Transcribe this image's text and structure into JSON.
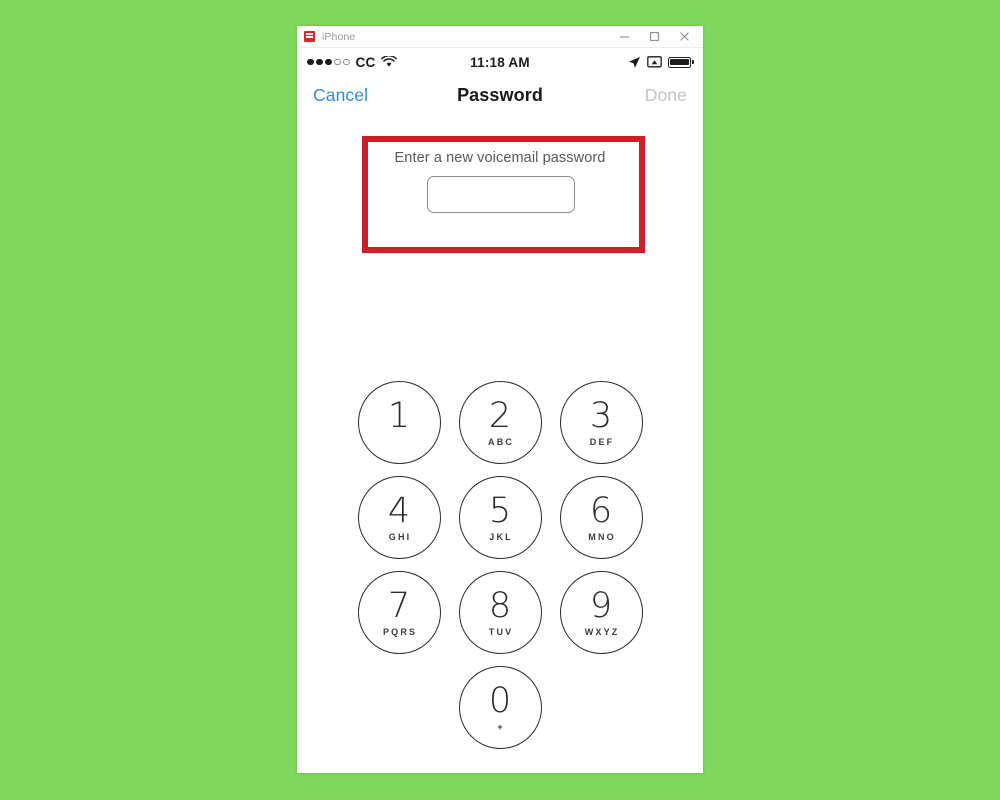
{
  "background_color": "#7fd85c",
  "window": {
    "title": "iPhone",
    "app_icon": "iphone-app-icon",
    "controls": [
      {
        "name": "minimize",
        "icon": "minimize-icon"
      },
      {
        "name": "maximize",
        "icon": "maximize-icon"
      },
      {
        "name": "close",
        "icon": "close-icon"
      }
    ]
  },
  "status_bar": {
    "signal_dots_filled": 3,
    "signal_dots_total": 5,
    "carrier": "CC",
    "wifi_icon": "wifi-icon",
    "time": "11:18 AM",
    "location_icon": "location-arrow-icon",
    "screen_mirror_icon": "screen-mirroring-icon",
    "battery_icon": "battery-icon",
    "battery_level_percent": 100
  },
  "nav_bar": {
    "cancel_label": "Cancel",
    "title": "Password",
    "done_label": "Done",
    "cancel_color": "#2e8ce6",
    "done_color": "#c3c3c3"
  },
  "password_section": {
    "prompt": "Enter a new voicemail password",
    "input_value": "",
    "input_placeholder": "",
    "annotation_color": "#cc2027"
  },
  "keypad": {
    "rows": [
      [
        {
          "digit": "1",
          "letters": ""
        },
        {
          "digit": "2",
          "letters": "ABC"
        },
        {
          "digit": "3",
          "letters": "DEF"
        }
      ],
      [
        {
          "digit": "4",
          "letters": "GHI"
        },
        {
          "digit": "5",
          "letters": "JKL"
        },
        {
          "digit": "6",
          "letters": "MNO"
        }
      ],
      [
        {
          "digit": "7",
          "letters": "PQRS"
        },
        {
          "digit": "8",
          "letters": "TUV"
        },
        {
          "digit": "9",
          "letters": "WXYZ"
        }
      ],
      [
        {
          "digit": "0",
          "letters": "+"
        }
      ]
    ]
  }
}
